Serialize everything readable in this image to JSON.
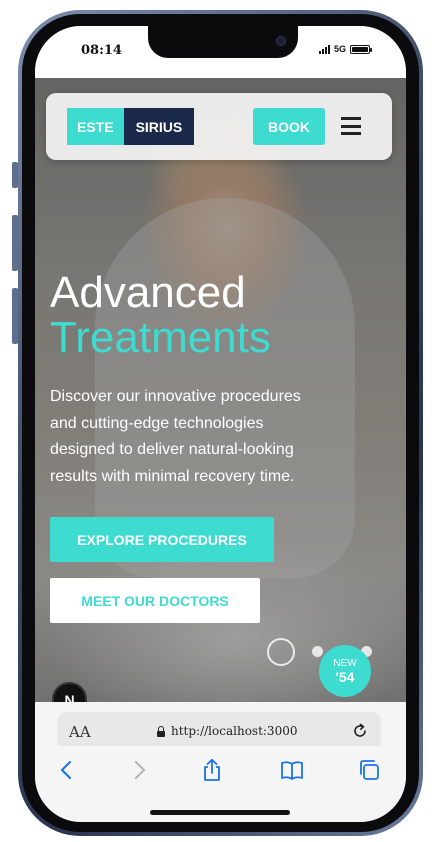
{
  "status_bar": {
    "time": "08:14",
    "network": "5G"
  },
  "header": {
    "logo_part1": "ESTE",
    "logo_part2": "SIRIUS",
    "book_label": "BOOK"
  },
  "hero": {
    "title_line1": "Advanced",
    "title_line2": "Treatments",
    "description": "Discover our innovative procedures and cutting-edge technologies designed to deliver natural-looking results with minimal recovery time.",
    "primary_button": "EXPLORE PROCEDURES",
    "secondary_button": "MEET OUR DOCTORS",
    "badge_top": "NEW",
    "badge_number": "'54",
    "dev_badge": "N"
  },
  "browser": {
    "text_size_label": "AA",
    "url": "http://localhost:3000"
  },
  "colors": {
    "accent": "#3ddbd0",
    "navy": "#1b2a4a",
    "ios_blue": "#1a73e8"
  },
  "icons": [
    "menu-icon",
    "lock-icon",
    "reload-icon",
    "back-icon",
    "forward-icon",
    "share-icon",
    "bookmarks-icon",
    "tabs-icon"
  ]
}
